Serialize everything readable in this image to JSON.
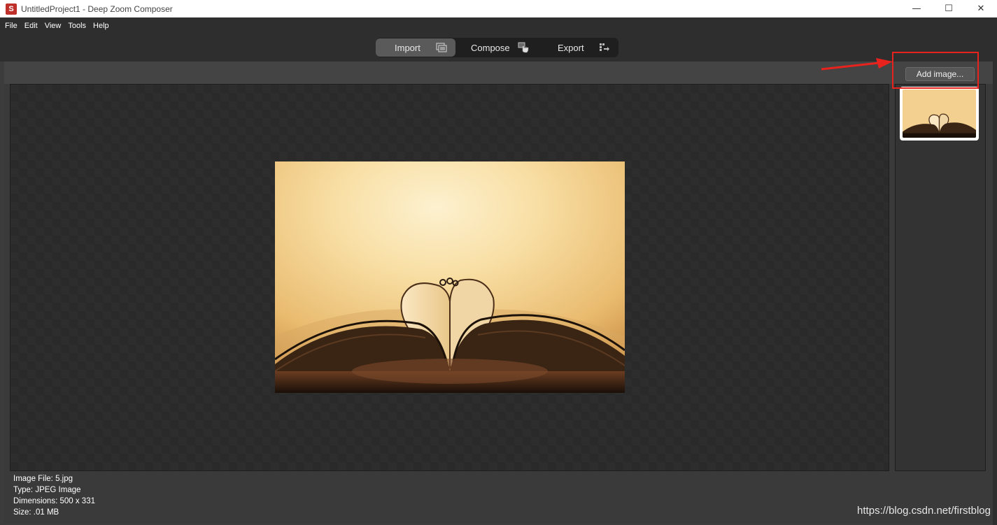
{
  "window": {
    "title": "UntitledProject1 - Deep Zoom Composer",
    "app_icon_letter": "S",
    "minimize": "—",
    "maximize": "☐",
    "close": "✕"
  },
  "menu": [
    "File",
    "Edit",
    "View",
    "Tools",
    "Help"
  ],
  "modes": {
    "import": "Import",
    "compose": "Compose",
    "export": "Export",
    "active": "Import"
  },
  "panel": {
    "add_image_label": "Add image..."
  },
  "image_info": {
    "file": "Image File: 5.jpg",
    "type": "Type: JPEG Image",
    "dimensions": "Dimensions: 500 x 331",
    "size": "Size: .01 MB"
  },
  "watermark": "https://blog.csdn.net/firstblog",
  "colors": {
    "highlight": "#e8231e",
    "photo_glow": "#fbe7b4",
    "photo_dark": "#1f140c"
  },
  "icons": {
    "import": "import-icon",
    "compose": "hand-cursor-icon",
    "export": "export-icon"
  }
}
